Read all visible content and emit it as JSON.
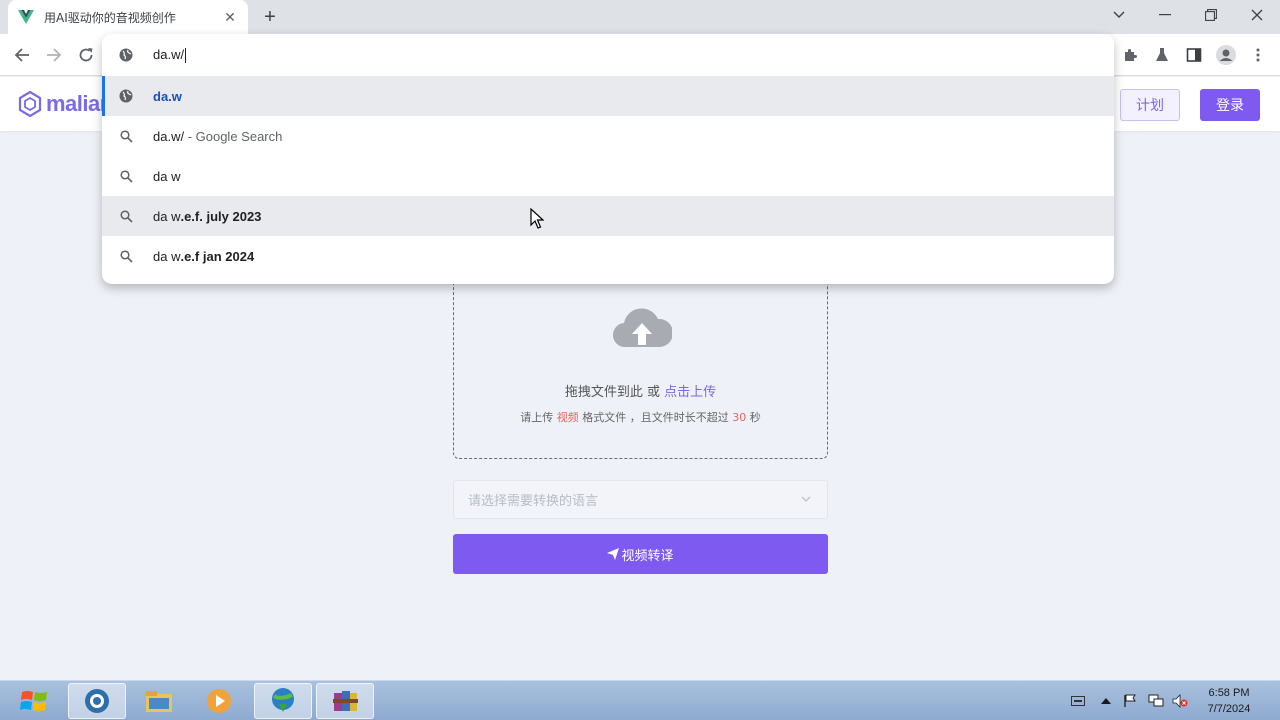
{
  "browser": {
    "tab_title": "用AI驱动你的音视频创作",
    "omnibox_value": "da.w/",
    "suggestions": [
      {
        "type": "url",
        "normal": "",
        "bold": "da.w",
        "suffix": ""
      },
      {
        "type": "search",
        "normal": "da.w/",
        "bold": "",
        "suffix": " - Google Search"
      },
      {
        "type": "search",
        "normal": "da w",
        "bold": "",
        "suffix": ""
      },
      {
        "type": "search",
        "normal": "da w",
        "bold": ".e.f. july 2023",
        "suffix": ""
      },
      {
        "type": "search",
        "normal": "da w",
        "bold": ".e.f jan 2024",
        "suffix": ""
      }
    ]
  },
  "site": {
    "logo_text": "malian",
    "plan_label": "计划",
    "login_label": "登录"
  },
  "upload": {
    "main_prefix": "拖拽文件到此 或 ",
    "main_link": "点击上传",
    "sub_a": "请上传 ",
    "sub_red": "视频",
    "sub_b": " 格式文件 ，且文件时长不超过 ",
    "sub_num": "30",
    "sub_c": " 秒"
  },
  "language_select": {
    "placeholder": "请选择需要转换的语言"
  },
  "translate_button": {
    "label": "视频转译"
  },
  "taskbar": {
    "time": "6:58 PM",
    "date": "7/7/2024"
  },
  "colors": {
    "accent": "#7f5af0",
    "link": "#7a67e8",
    "warn": "#e8635c"
  }
}
